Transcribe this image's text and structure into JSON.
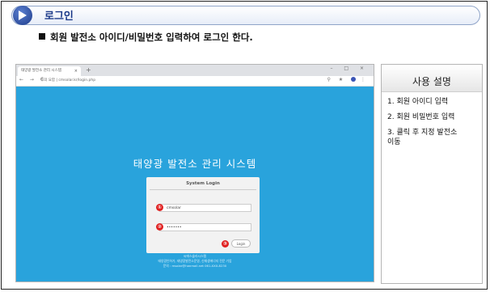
{
  "header": {
    "title": "로그인"
  },
  "subtitle": "회원 발전소 아이디/비밀번호 입력하여 로그인 한다.",
  "browser": {
    "tab_title": "태양광 발전소 관리 시스템",
    "tab_close": "×",
    "new_tab": "+",
    "window_controls": "– □ ×",
    "nav_buttons": "← → C",
    "url": "주의 요함 | cmsolar.kr/login.php"
  },
  "page": {
    "system_title": "태양광 발전소 관리 시스템",
    "login_title": "System Login",
    "id_value": "cmsolar",
    "password_value": "•••••••",
    "login_button": "Login",
    "footer_line1": "씨에스솔라시스템",
    "footer_line2": "태양광인허가, 태양광발전소운영, 신재생에너지 전문 기업",
    "footer_line3": "문의 : msolar@hanmail.net 061-XXX-8230"
  },
  "badges": [
    "①",
    "②",
    "③"
  ],
  "help": {
    "title": "사용 설명",
    "steps": [
      "1. 회원 아이디 입력",
      "2. 회원 비밀번호 입력",
      "3. 클릭 후 지정 발전소\n    이동"
    ]
  },
  "colors": {
    "page_bg": "#29a3dc",
    "badge": "#e02020",
    "banner_text": "#1d3b8a"
  }
}
